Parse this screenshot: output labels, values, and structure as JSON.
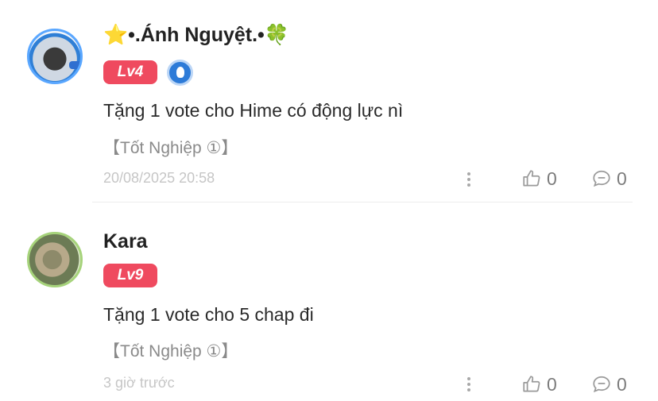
{
  "comments": [
    {
      "name": "⭐•.Ánh Nguyệt.•🍀",
      "level": "Lv4",
      "text": "Tặng 1 vote cho Hime có động lực nì",
      "tag": "【Tốt Nghiệp ①】",
      "time": "20/08/2025 20:58",
      "likes": "0",
      "replies": "0"
    },
    {
      "name": "Kara",
      "level": "Lv9",
      "text": "Tặng 1 vote cho 5 chap đi",
      "tag": "【Tốt Nghiệp ①】",
      "time": "3 giờ trước",
      "likes": "0",
      "replies": "0"
    }
  ],
  "colors": {
    "level_badge": "#ef4a5f",
    "muted_text": "#c6c6c6"
  },
  "icons": [
    "more-vertical-icon",
    "thumbs-up-icon",
    "comment-bubble-icon",
    "medal-icon"
  ]
}
